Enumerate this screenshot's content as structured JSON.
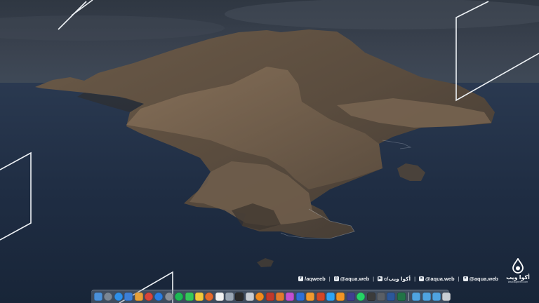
{
  "wallpaper": {
    "name": "macOS Catalina island wallpaper"
  },
  "social": {
    "facebook": {
      "icon": "facebook-icon",
      "handle": "/aqweeb"
    },
    "instagram": {
      "icon": "instagram-icon",
      "handle": "@aqua.web"
    },
    "youtube": {
      "icon": "youtube-icon",
      "handle": "c/أكوا ويب"
    },
    "telegram": {
      "icon": "telegram-icon",
      "handle": "@aqua.web"
    },
    "twitter": {
      "icon": "twitter-icon",
      "handle": "@aqua.web"
    },
    "separator": "|"
  },
  "logo": {
    "name": "أكوا ويب",
    "url": "www.aqweeb.com"
  },
  "dock": {
    "apps": [
      {
        "name": "finder",
        "color": "#4a90d9"
      },
      {
        "name": "launchpad",
        "color": "#7a8694"
      },
      {
        "name": "safari",
        "color": "#2f8fe8"
      },
      {
        "name": "mail",
        "color": "#3d7fd6"
      },
      {
        "name": "photos",
        "color": "#e6a03a"
      },
      {
        "name": "chrome",
        "color": "#d9453a"
      },
      {
        "name": "app-store",
        "color": "#2a7de1"
      },
      {
        "name": "settings",
        "color": "#8a9098"
      },
      {
        "name": "spotify",
        "color": "#1db954"
      },
      {
        "name": "messages",
        "color": "#34c759"
      },
      {
        "name": "notes",
        "color": "#f3c83a"
      },
      {
        "name": "firefox",
        "color": "#e66a2c"
      },
      {
        "name": "calendar",
        "color": "#f2f2f2"
      },
      {
        "name": "preview",
        "color": "#9aa6b4"
      },
      {
        "name": "terminal",
        "color": "#2b2b2b"
      },
      {
        "name": "finder-window",
        "color": "#c9ced4"
      },
      {
        "name": "vlc",
        "color": "#f08a1c"
      },
      {
        "name": "filezilla",
        "color": "#c0392b"
      },
      {
        "name": "sublime-text",
        "color": "#e07a2d"
      },
      {
        "name": "adobe-xd",
        "color": "#c24fd1"
      },
      {
        "name": "keynote",
        "color": "#2f6fd6"
      },
      {
        "name": "pages",
        "color": "#f29a2e"
      },
      {
        "name": "powerpoint",
        "color": "#d24726"
      },
      {
        "name": "photoshop",
        "color": "#2da4f5"
      },
      {
        "name": "illustrator",
        "color": "#f29424"
      },
      {
        "name": "pr-cc",
        "color": "#3f3f8f"
      },
      {
        "name": "whatsapp",
        "color": "#25d366"
      },
      {
        "name": "activity-monitor",
        "color": "#3b3b3b"
      },
      {
        "name": "calculator",
        "color": "#5a5f66"
      },
      {
        "name": "word",
        "color": "#2b579a"
      },
      {
        "name": "excel",
        "color": "#217346"
      }
    ],
    "folders": [
      {
        "name": "applications-folder",
        "color": "#4fa3e0"
      },
      {
        "name": "downloads-folder",
        "color": "#4fa3e0"
      },
      {
        "name": "documents-folder",
        "color": "#4fa3e0"
      }
    ],
    "trash": {
      "name": "trash",
      "color": "#c9ced4"
    }
  }
}
